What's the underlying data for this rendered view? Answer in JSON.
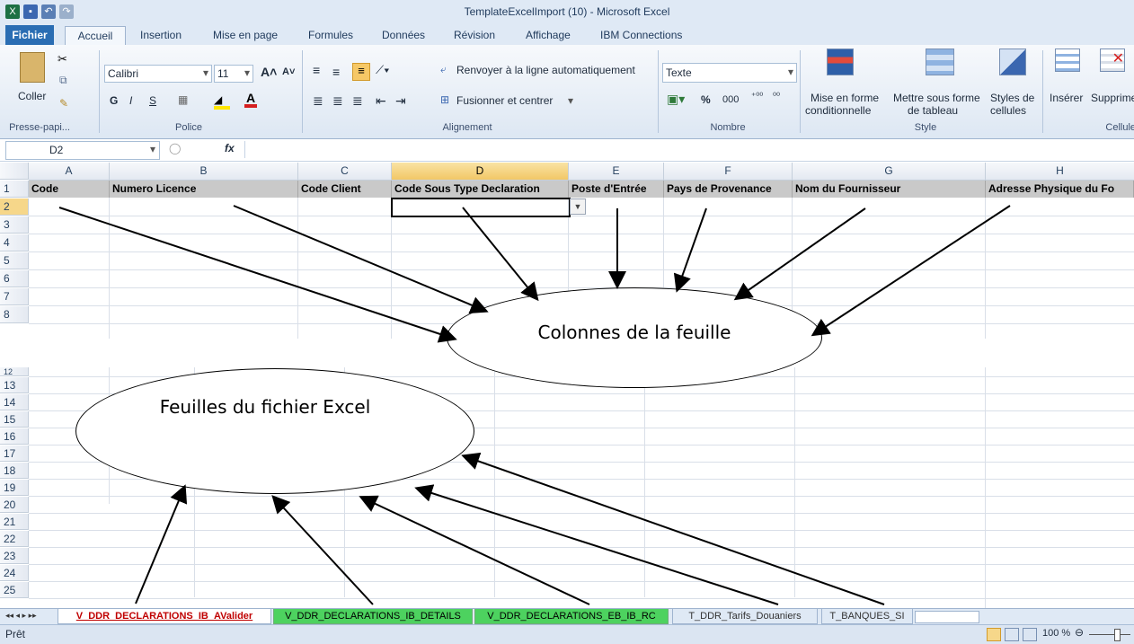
{
  "window": {
    "title": "TemplateExcelImport (10)  -  Microsoft Excel"
  },
  "tabs": [
    "Fichier",
    "Accueil",
    "Insertion",
    "Mise en page",
    "Formules",
    "Données",
    "Révision",
    "Affichage",
    "IBM Connections"
  ],
  "ribbon": {
    "clipboard": {
      "paste": "Coller",
      "label": "Presse-papi..."
    },
    "font": {
      "name": "Calibri",
      "size": "11",
      "bold": "G",
      "italic": "I",
      "underline": "S",
      "label": "Police"
    },
    "alignment": {
      "wrap": "Renvoyer à la ligne automatiquement",
      "merge": "Fusionner et centrer",
      "label": "Alignement"
    },
    "number": {
      "format": "Texte",
      "percent": "%",
      "thousands": "000",
      "label": "Nombre"
    },
    "style": {
      "cond_a": "Mise en forme",
      "cond_b": "conditionnelle",
      "table_a": "Mettre sous forme",
      "table_b": "de tableau",
      "cell_a": "Styles de",
      "cell_b": "cellules",
      "label": "Style"
    },
    "cells": {
      "insert": "Insérer",
      "delete": "Supprime",
      "label": "Cellules"
    }
  },
  "formula_bar": {
    "name_box": "D2",
    "fx": "fx"
  },
  "columns": [
    "A",
    "B",
    "C",
    "D",
    "E",
    "F",
    "G",
    "H"
  ],
  "header_row": [
    "Code",
    "Numero Licence",
    "Code Client",
    "Code Sous Type Declaration",
    "Poste d'Entrée",
    "Pays de Provenance",
    "Nom du Fournisseur",
    "Adresse Physique du Fo"
  ],
  "rows_top": [
    "1",
    "2",
    "3",
    "4",
    "5",
    "6",
    "7",
    "8"
  ],
  "rows_bottom": [
    "12",
    "13",
    "14",
    "15",
    "16",
    "17",
    "18",
    "19",
    "20",
    "21",
    "22",
    "23",
    "24",
    "25"
  ],
  "annotations": {
    "columns": "Colonnes de la feuille",
    "sheets": "Feuilles du fichier Excel"
  },
  "sheet_tabs": [
    "V_DDR_DECLARATIONS_IB_AValider",
    "V_DDR_DECLARATIONS_IB_DETAILS",
    "V_DDR_DECLARATIONS_EB_IB_RC",
    "T_DDR_Tarifs_Douaniers",
    "T_BANQUES_SI"
  ],
  "status": {
    "ready": "Prêt",
    "zoom": "100 %"
  }
}
